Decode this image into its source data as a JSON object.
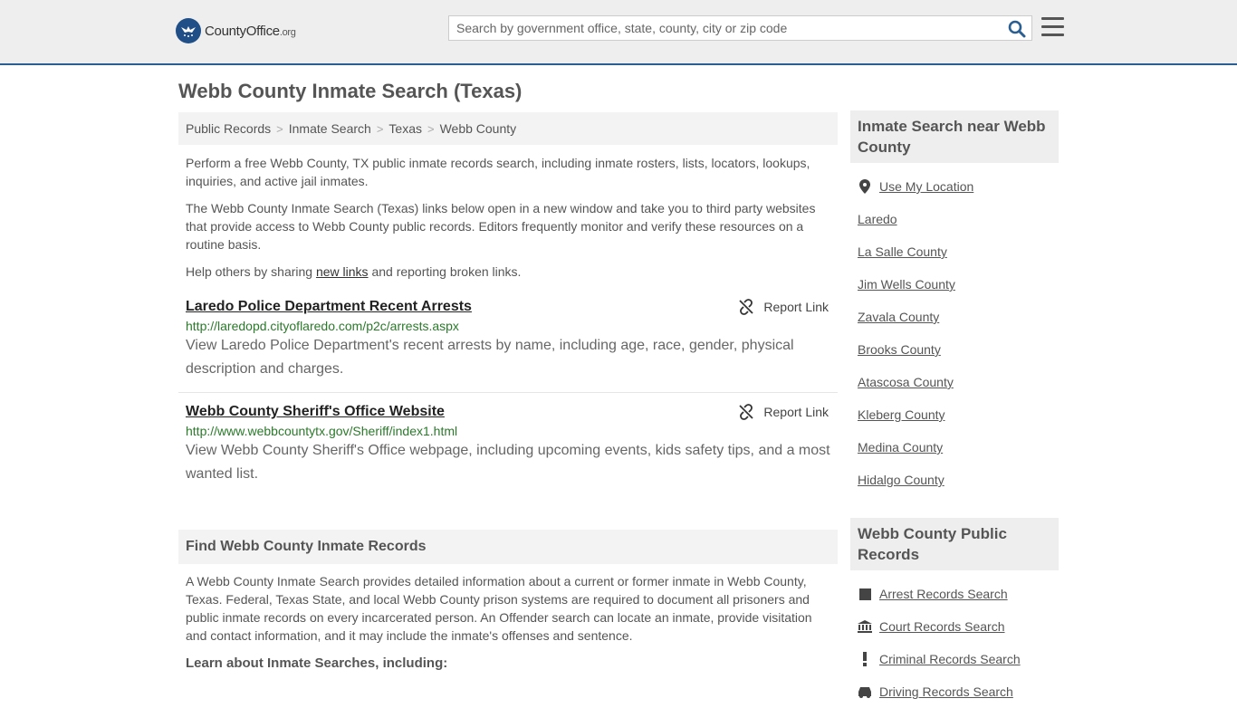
{
  "header": {
    "logo_main": "CountyOffice",
    "logo_tld": ".org",
    "search_placeholder": "Search by government office, state, county, city or zip code"
  },
  "page": {
    "title": "Webb County Inmate Search (Texas)"
  },
  "breadcrumb": [
    "Public Records",
    "Inmate Search",
    "Texas",
    "Webb County"
  ],
  "intro": {
    "p1": "Perform a free Webb County, TX public inmate records search, including inmate rosters, lists, locators, lookups, inquiries, and active jail inmates.",
    "p2": "The Webb County Inmate Search (Texas) links below open in a new window and take you to third party websites that provide access to Webb County public records. Editors frequently monitor and verify these resources on a routine basis.",
    "p3_before": "Help others by sharing ",
    "p3_link": "new links",
    "p3_after": " and reporting broken links."
  },
  "links": [
    {
      "title": "Laredo Police Department Recent Arrests",
      "url": "http://laredopd.cityoflaredo.com/p2c/arrests.aspx",
      "desc": "View Laredo Police Department's recent arrests by name, including age, race, gender, physical description and charges.",
      "report_label": "Report Link"
    },
    {
      "title": "Webb County Sheriff's Office Website",
      "url": "http://www.webbcountytx.gov/Sheriff/index1.html",
      "desc": "View Webb County Sheriff's Office webpage, including upcoming events, kids safety tips, and a most wanted list.",
      "report_label": "Report Link"
    }
  ],
  "find_section": {
    "heading": "Find Webb County Inmate Records",
    "body": "A Webb County Inmate Search provides detailed information about a current or former inmate in Webb County, Texas. Federal, Texas State, and local Webb County prison systems are required to document all prisoners and public inmate records on every incarcerated person. An Offender search can locate an inmate, provide visitation and contact information, and it may include the inmate's offenses and sentence.",
    "learn_heading": "Learn about Inmate Searches, including:"
  },
  "sidebar": {
    "nearby_heading": "Inmate Search near Webb County",
    "nearby": [
      "Use My Location",
      "Laredo",
      "La Salle County",
      "Jim Wells County",
      "Zavala County",
      "Brooks County",
      "Atascosa County",
      "Kleberg County",
      "Medina County",
      "Hidalgo County"
    ],
    "records_heading": "Webb County Public Records",
    "records": [
      {
        "label": "Arrest Records Search",
        "icon": "square-icon"
      },
      {
        "label": "Court Records Search",
        "icon": "courthouse-icon"
      },
      {
        "label": "Criminal Records Search",
        "icon": "exclamation-icon"
      },
      {
        "label": "Driving Records Search",
        "icon": "car-icon"
      }
    ]
  },
  "colors": {
    "header_bg": "#eeeeee",
    "header_border": "#2b5f92",
    "logo_blue": "#1f4f86",
    "search_icon": "#2b5f92",
    "url_green": "#2a7a2a"
  }
}
